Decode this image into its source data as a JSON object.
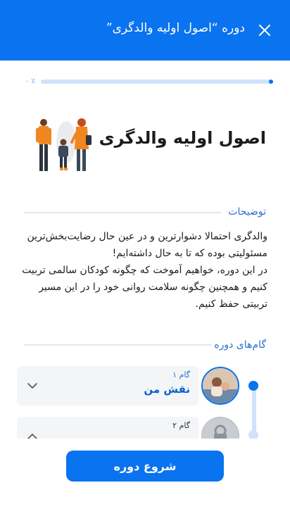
{
  "header": {
    "title": "دوره “اصول اولیه والدگری”"
  },
  "progress": {
    "label": "۰ ٪",
    "fraction": 0
  },
  "course": {
    "title": "اصول اولیه والدگری"
  },
  "description": {
    "heading": "توضیحات",
    "paragraphs": [
      "والدگری احتمالا دشوارترین و در عین حال رضایت‌بخش‌ترین مسئولیتی بوده که تا به حال داشته‌ایم!",
      "در این دوره، خواهیم آموخت که چگونه کودکان سالمی تربیت کنیم و همچنین چگونه سلامت روانی خود را در این مسیر تربیتی حفظ کنیم."
    ]
  },
  "steps": {
    "heading": "گام‌های دوره",
    "items": [
      {
        "number": "گام ۱",
        "name": "نقش من"
      },
      {
        "number": "گام ۲",
        "name": ""
      }
    ]
  },
  "cta": {
    "label": "شروع دوره"
  },
  "colors": {
    "primary": "#0a73f0",
    "track": "#cfe3fb",
    "card": "#f4f5f7"
  }
}
